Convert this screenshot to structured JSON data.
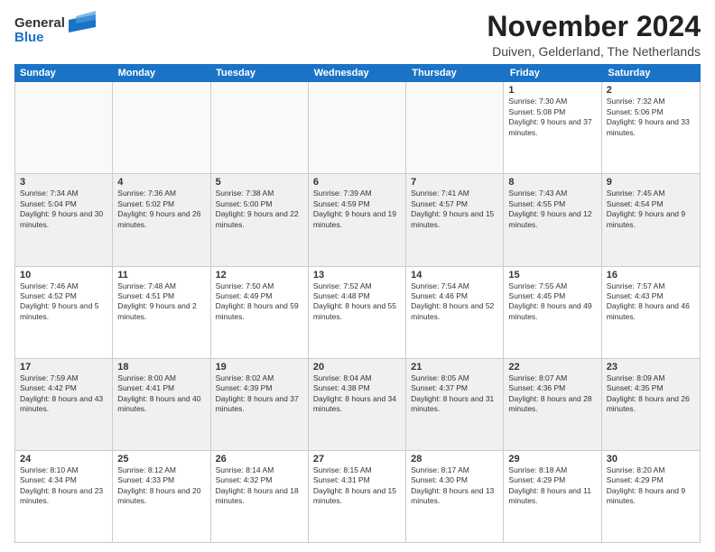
{
  "logo": {
    "line1": "General",
    "line2": "Blue"
  },
  "header": {
    "month": "November 2024",
    "location": "Duiven, Gelderland, The Netherlands"
  },
  "weekdays": [
    "Sunday",
    "Monday",
    "Tuesday",
    "Wednesday",
    "Thursday",
    "Friday",
    "Saturday"
  ],
  "weeks": [
    [
      {
        "day": "",
        "text": "",
        "empty": true
      },
      {
        "day": "",
        "text": "",
        "empty": true
      },
      {
        "day": "",
        "text": "",
        "empty": true
      },
      {
        "day": "",
        "text": "",
        "empty": true
      },
      {
        "day": "",
        "text": "",
        "empty": true
      },
      {
        "day": "1",
        "text": "Sunrise: 7:30 AM\nSunset: 5:08 PM\nDaylight: 9 hours and 37 minutes.",
        "empty": false
      },
      {
        "day": "2",
        "text": "Sunrise: 7:32 AM\nSunset: 5:06 PM\nDaylight: 9 hours and 33 minutes.",
        "empty": false
      }
    ],
    [
      {
        "day": "3",
        "text": "Sunrise: 7:34 AM\nSunset: 5:04 PM\nDaylight: 9 hours and 30 minutes.",
        "empty": false
      },
      {
        "day": "4",
        "text": "Sunrise: 7:36 AM\nSunset: 5:02 PM\nDaylight: 9 hours and 26 minutes.",
        "empty": false
      },
      {
        "day": "5",
        "text": "Sunrise: 7:38 AM\nSunset: 5:00 PM\nDaylight: 9 hours and 22 minutes.",
        "empty": false
      },
      {
        "day": "6",
        "text": "Sunrise: 7:39 AM\nSunset: 4:59 PM\nDaylight: 9 hours and 19 minutes.",
        "empty": false
      },
      {
        "day": "7",
        "text": "Sunrise: 7:41 AM\nSunset: 4:57 PM\nDaylight: 9 hours and 15 minutes.",
        "empty": false
      },
      {
        "day": "8",
        "text": "Sunrise: 7:43 AM\nSunset: 4:55 PM\nDaylight: 9 hours and 12 minutes.",
        "empty": false
      },
      {
        "day": "9",
        "text": "Sunrise: 7:45 AM\nSunset: 4:54 PM\nDaylight: 9 hours and 9 minutes.",
        "empty": false
      }
    ],
    [
      {
        "day": "10",
        "text": "Sunrise: 7:46 AM\nSunset: 4:52 PM\nDaylight: 9 hours and 5 minutes.",
        "empty": false
      },
      {
        "day": "11",
        "text": "Sunrise: 7:48 AM\nSunset: 4:51 PM\nDaylight: 9 hours and 2 minutes.",
        "empty": false
      },
      {
        "day": "12",
        "text": "Sunrise: 7:50 AM\nSunset: 4:49 PM\nDaylight: 8 hours and 59 minutes.",
        "empty": false
      },
      {
        "day": "13",
        "text": "Sunrise: 7:52 AM\nSunset: 4:48 PM\nDaylight: 8 hours and 55 minutes.",
        "empty": false
      },
      {
        "day": "14",
        "text": "Sunrise: 7:54 AM\nSunset: 4:46 PM\nDaylight: 8 hours and 52 minutes.",
        "empty": false
      },
      {
        "day": "15",
        "text": "Sunrise: 7:55 AM\nSunset: 4:45 PM\nDaylight: 8 hours and 49 minutes.",
        "empty": false
      },
      {
        "day": "16",
        "text": "Sunrise: 7:57 AM\nSunset: 4:43 PM\nDaylight: 8 hours and 46 minutes.",
        "empty": false
      }
    ],
    [
      {
        "day": "17",
        "text": "Sunrise: 7:59 AM\nSunset: 4:42 PM\nDaylight: 8 hours and 43 minutes.",
        "empty": false
      },
      {
        "day": "18",
        "text": "Sunrise: 8:00 AM\nSunset: 4:41 PM\nDaylight: 8 hours and 40 minutes.",
        "empty": false
      },
      {
        "day": "19",
        "text": "Sunrise: 8:02 AM\nSunset: 4:39 PM\nDaylight: 8 hours and 37 minutes.",
        "empty": false
      },
      {
        "day": "20",
        "text": "Sunrise: 8:04 AM\nSunset: 4:38 PM\nDaylight: 8 hours and 34 minutes.",
        "empty": false
      },
      {
        "day": "21",
        "text": "Sunrise: 8:05 AM\nSunset: 4:37 PM\nDaylight: 8 hours and 31 minutes.",
        "empty": false
      },
      {
        "day": "22",
        "text": "Sunrise: 8:07 AM\nSunset: 4:36 PM\nDaylight: 8 hours and 28 minutes.",
        "empty": false
      },
      {
        "day": "23",
        "text": "Sunrise: 8:09 AM\nSunset: 4:35 PM\nDaylight: 8 hours and 26 minutes.",
        "empty": false
      }
    ],
    [
      {
        "day": "24",
        "text": "Sunrise: 8:10 AM\nSunset: 4:34 PM\nDaylight: 8 hours and 23 minutes.",
        "empty": false
      },
      {
        "day": "25",
        "text": "Sunrise: 8:12 AM\nSunset: 4:33 PM\nDaylight: 8 hours and 20 minutes.",
        "empty": false
      },
      {
        "day": "26",
        "text": "Sunrise: 8:14 AM\nSunset: 4:32 PM\nDaylight: 8 hours and 18 minutes.",
        "empty": false
      },
      {
        "day": "27",
        "text": "Sunrise: 8:15 AM\nSunset: 4:31 PM\nDaylight: 8 hours and 15 minutes.",
        "empty": false
      },
      {
        "day": "28",
        "text": "Sunrise: 8:17 AM\nSunset: 4:30 PM\nDaylight: 8 hours and 13 minutes.",
        "empty": false
      },
      {
        "day": "29",
        "text": "Sunrise: 8:18 AM\nSunset: 4:29 PM\nDaylight: 8 hours and 11 minutes.",
        "empty": false
      },
      {
        "day": "30",
        "text": "Sunrise: 8:20 AM\nSunset: 4:29 PM\nDaylight: 8 hours and 9 minutes.",
        "empty": false
      }
    ]
  ]
}
